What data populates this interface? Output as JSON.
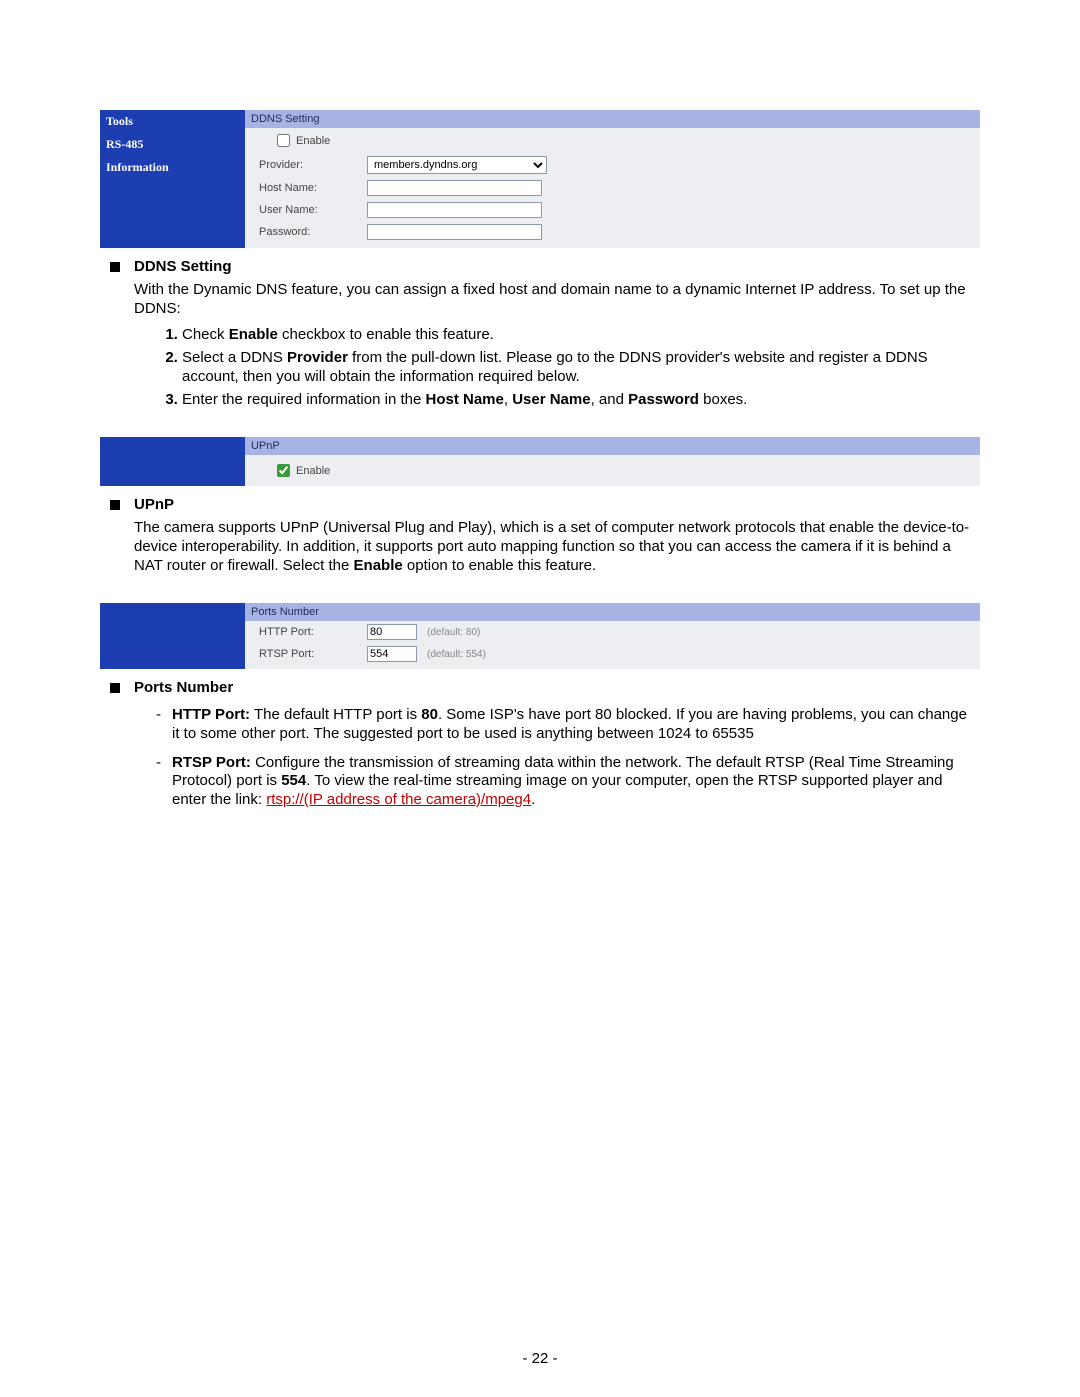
{
  "ddns_panel": {
    "sidebar_items": [
      "Tools",
      "RS-485",
      "Information"
    ],
    "section_title": "DDNS Setting",
    "enable_label": "Enable",
    "enable_checked": false,
    "fields": {
      "provider_label": "Provider:",
      "provider_value": "members.dyndns.org",
      "hostname_label": "Host Name:",
      "hostname_value": "",
      "username_label": "User Name:",
      "username_value": "",
      "password_label": "Password:",
      "password_value": ""
    }
  },
  "upnp_panel": {
    "section_title": "UPnP",
    "enable_label": "Enable",
    "enable_checked": true
  },
  "ports_panel": {
    "section_title": "Ports Number",
    "http_label": "HTTP Port:",
    "http_value": "80",
    "http_default": "(default: 80)",
    "rtsp_label": "RTSP Port:",
    "rtsp_value": "554",
    "rtsp_default": "(default: 554)"
  },
  "doc": {
    "ddns": {
      "title": "DDNS Setting",
      "intro": "With the Dynamic DNS feature, you can assign a fixed host and domain name to a dynamic Internet IP address. To set up the DDNS:",
      "step1_pre": "Check ",
      "step1_bold": "Enable",
      "step1_post": " checkbox to enable this feature.",
      "step2_pre": "Select a DDNS ",
      "step2_bold": "Provider",
      "step2_post": " from the pull-down list. Please go to the DDNS provider's website and register a DDNS account, then you will obtain the information required below.",
      "step3_pre": "Enter the required information in the ",
      "step3_b1": "Host Name",
      "step3_sep1": ", ",
      "step3_b2": "User Name",
      "step3_sep2": ", and ",
      "step3_b3": "Password",
      "step3_post": " boxes."
    },
    "upnp": {
      "title": "UPnP",
      "text_pre": "The camera supports UPnP (Universal Plug and Play), which is a set of computer network protocols that enable the device-to-device interoperability. In addition, it supports port auto mapping function so that you can access the camera if it is behind a NAT router or firewall. Select the ",
      "text_bold": "Enable",
      "text_post": " option to enable this feature."
    },
    "ports": {
      "title": "Ports Number",
      "http_b1": "HTTP Port:",
      "http_pre": " The default HTTP port is ",
      "http_b2": "80",
      "http_post": ".  Some ISP's have port 80 blocked.  If you are having problems, you can change it to some other port.  The suggested port to be used is anything between 1024 to 65535",
      "rtsp_b1": "RTSP Port:",
      "rtsp_pre": " Configure the transmission of streaming data within the network. The default RTSP (Real Time Streaming Protocol) port is ",
      "rtsp_b2": "554",
      "rtsp_post": ". To view the real-time streaming image on your computer, open the RTSP supported player and enter the link: ",
      "rtsp_link": "rtsp://(IP address of the camera)/mpeg4",
      "rtsp_end": "."
    }
  },
  "page_number": "- 22 -"
}
